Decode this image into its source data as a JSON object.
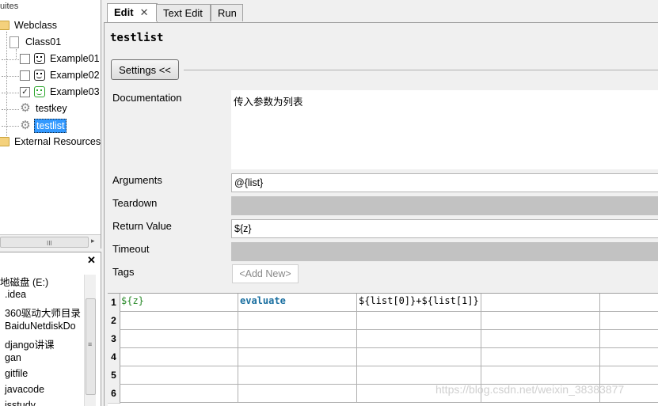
{
  "tree": {
    "header": "uites",
    "items": [
      {
        "label": "Webclass"
      },
      {
        "label": "Class01"
      },
      {
        "label": "Example01",
        "checked": false
      },
      {
        "label": "Example02",
        "checked": false
      },
      {
        "label": "Example03",
        "checked": true
      },
      {
        "label": "testkey"
      },
      {
        "label": "testlist"
      },
      {
        "label": "External Resources"
      }
    ],
    "scroll_grip": "III",
    "scroll_arrow": "▸"
  },
  "filebrowser": {
    "close": "✕",
    "items": [
      "地磁盘 (E:)",
      ".idea",
      "360驱动大师目录",
      "BaiduNetdiskDo",
      "django讲课",
      "gan",
      "gitfile",
      "javacode",
      "jsstudy"
    ],
    "scroll_grip": "≡"
  },
  "tabs": [
    {
      "label": "Edit",
      "close": "✕"
    },
    {
      "label": "Text Edit"
    },
    {
      "label": "Run"
    }
  ],
  "editor": {
    "title": "testlist",
    "settings_button": "Settings <<",
    "fields": {
      "documentation_label": "Documentation",
      "documentation_value": "传入参数为列表",
      "arguments_label": "Arguments",
      "arguments_value": "@{list}",
      "teardown_label": "Teardown",
      "return_label": "Return Value",
      "return_value": "${z}",
      "timeout_label": "Timeout",
      "tags_label": "Tags",
      "add_new": "<Add New>"
    }
  },
  "grid": {
    "rows": [
      {
        "num": "1",
        "cells": [
          "${z}",
          "evaluate",
          "${list[0]}+${list[1]}",
          "",
          ""
        ]
      },
      {
        "num": "2",
        "cells": [
          "",
          "",
          "",
          "",
          ""
        ]
      },
      {
        "num": "3",
        "cells": [
          "",
          "",
          "",
          "",
          ""
        ]
      },
      {
        "num": "4",
        "cells": [
          "",
          "",
          "",
          "",
          ""
        ]
      },
      {
        "num": "5",
        "cells": [
          "",
          "",
          "",
          "",
          ""
        ]
      },
      {
        "num": "6",
        "cells": [
          "",
          "",
          "",
          "",
          ""
        ]
      }
    ]
  },
  "colors": {
    "variable": "#2a8a2a",
    "keyword": "#1a6fa0",
    "selection": "#3399ff"
  },
  "watermark": "https://blog.csdn.net/weixin_38383877"
}
